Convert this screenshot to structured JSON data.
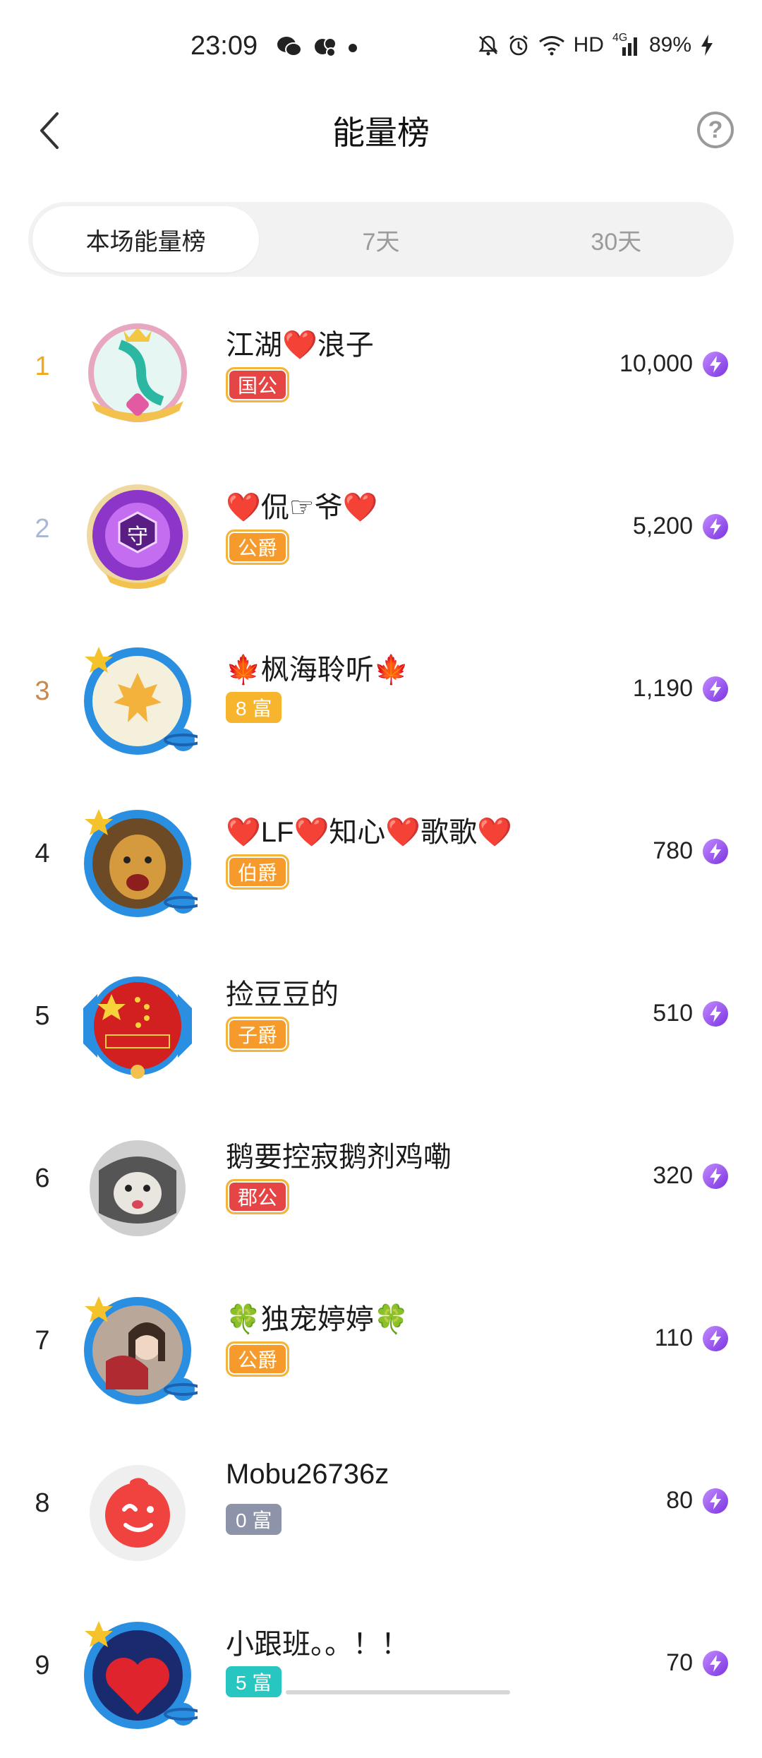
{
  "status_bar": {
    "time": "23:09",
    "battery": "89%",
    "network_label": "HD",
    "network_type": "4G",
    "icons": [
      "wechat-icon",
      "app-notification-icon",
      "mute-icon",
      "alarm-icon",
      "wifi-icon",
      "signal-icon",
      "charging-icon"
    ]
  },
  "header": {
    "title": "能量榜",
    "back_icon": "chevron-left-icon",
    "help_icon": "question-circle-icon"
  },
  "tabs": [
    {
      "label": "本场能量榜",
      "active": true
    },
    {
      "label": "7天",
      "active": false
    },
    {
      "label": "30天",
      "active": false
    }
  ],
  "ranking": [
    {
      "rank": "1",
      "name": "江湖❤️浪子",
      "badge": "国公",
      "energy": "10,000"
    },
    {
      "rank": "2",
      "name": "❤️侃☞爷❤️",
      "badge": "公爵",
      "energy": "5,200"
    },
    {
      "rank": "3",
      "name": "🍁枫海聆听🍁",
      "badge": "8 富",
      "energy": "1,190"
    },
    {
      "rank": "4",
      "name": "❤️LF❤️知心❤️歌歌❤️",
      "badge": "伯爵",
      "energy": "780"
    },
    {
      "rank": "5",
      "name": "捡豆豆的",
      "badge": "子爵",
      "energy": "510"
    },
    {
      "rank": "6",
      "name": "鹅要控寂鹅剂鸡嘞",
      "badge": "郡公",
      "energy": "320"
    },
    {
      "rank": "7",
      "name": "🍀独宠婷婷🍀",
      "badge": "公爵",
      "energy": "110"
    },
    {
      "rank": "8",
      "name": "Mobu26736z",
      "badge": "0 富",
      "energy": "80"
    },
    {
      "rank": "9",
      "name": "小跟班。。！！",
      "badge": "5 富",
      "energy": "70"
    }
  ],
  "colors": {
    "rank1": "#f2a81d",
    "rank2": "#a9b7d6",
    "rank3": "#c8884e",
    "energy_icon": "#8a3ff0",
    "badge_red": "#e64545",
    "badge_orange": "#f59a2b",
    "badge_gold": "#f6b52c",
    "badge_gray": "#8d93a8",
    "badge_teal": "#28c6c0"
  }
}
